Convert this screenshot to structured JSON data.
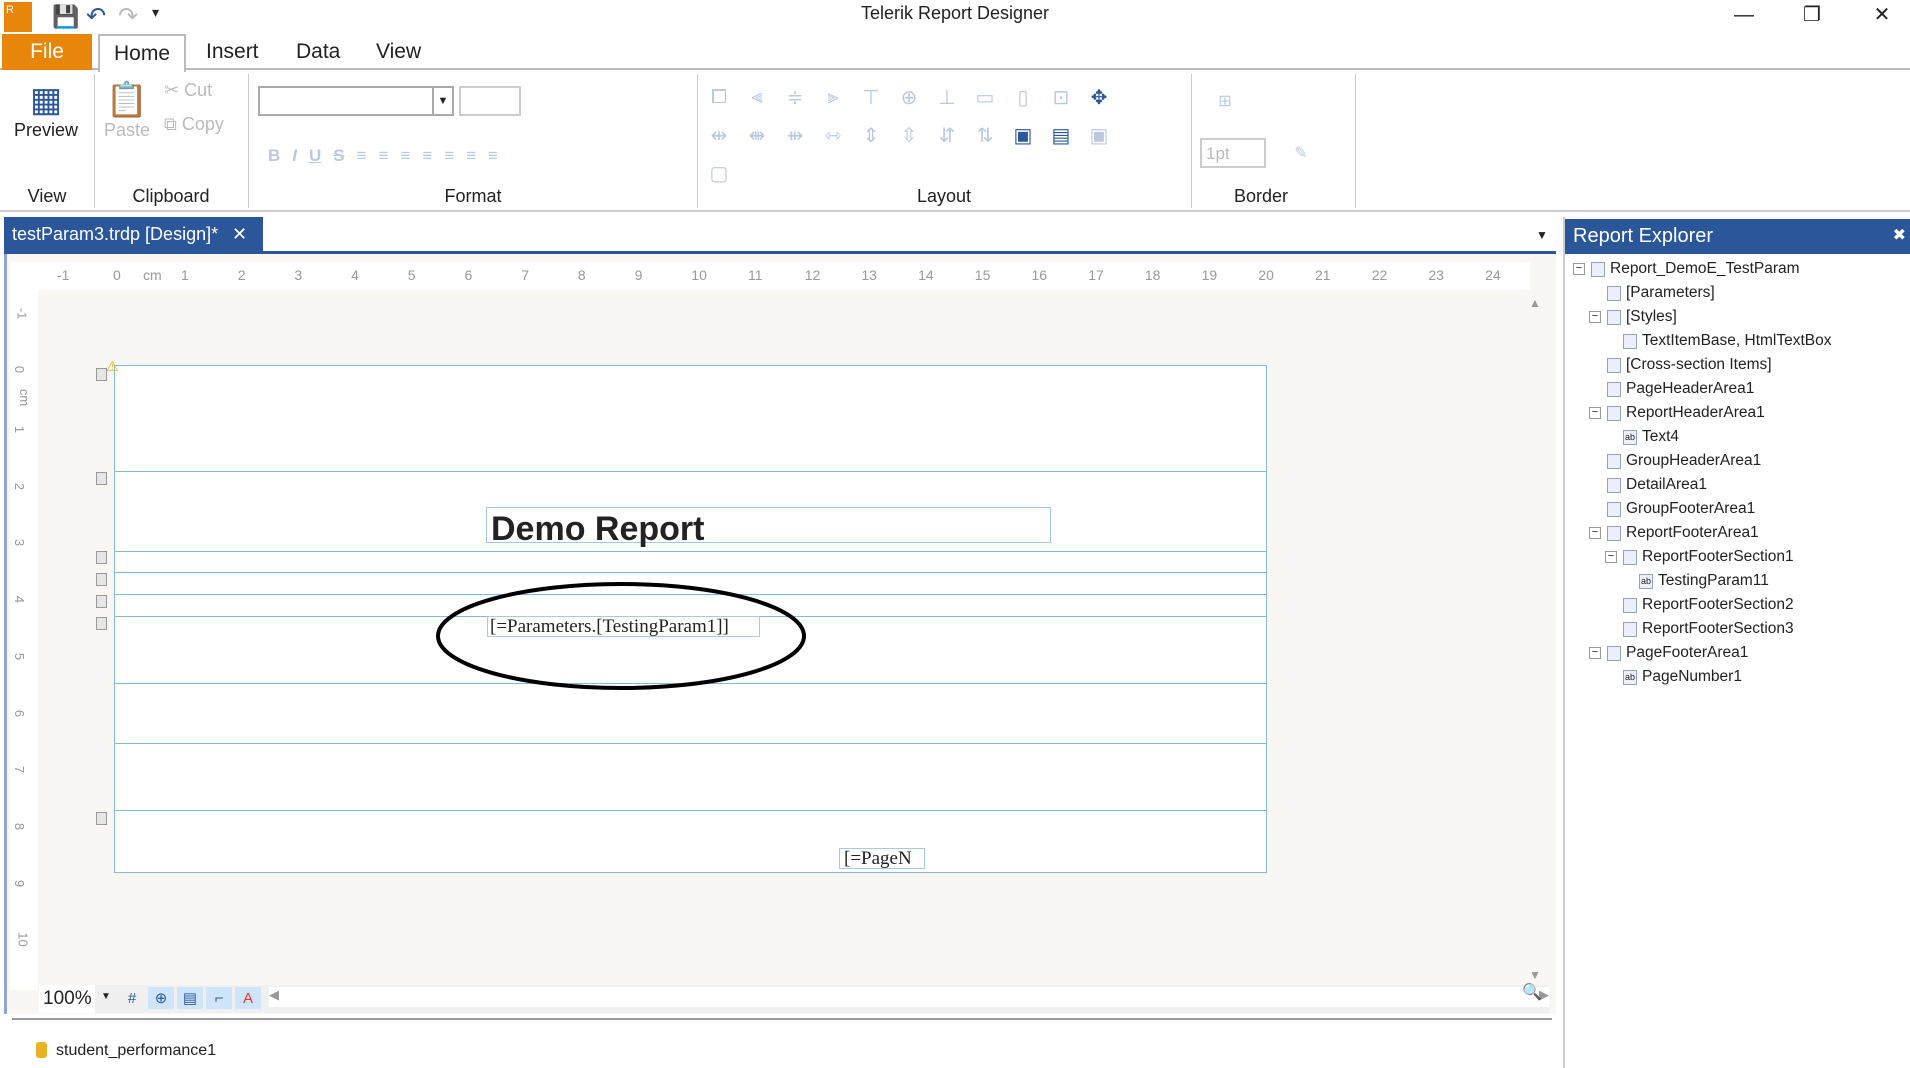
{
  "app": {
    "title": "Telerik Report Designer"
  },
  "quick_access": {
    "icons": [
      "app-logo-icon",
      "save-icon",
      "undo-icon",
      "redo-icon",
      "customize-icon"
    ]
  },
  "window_controls": {
    "minimize": "—",
    "restore": "❐",
    "close": "✕"
  },
  "ribbon": {
    "tabs": [
      {
        "label": "File"
      },
      {
        "label": "Home"
      },
      {
        "label": "Insert"
      },
      {
        "label": "Data"
      },
      {
        "label": "View"
      }
    ],
    "groups": {
      "view": "View",
      "clipboard": "Clipboard",
      "format": "Format",
      "layout": "Layout",
      "border": "Border"
    },
    "preview": "Preview",
    "paste": "Paste",
    "cut": "Cut",
    "copy": "Copy",
    "font_name": "",
    "font_size": "",
    "format_buttons": [
      "B",
      "I",
      "U",
      "S"
    ],
    "border_width": "1pt"
  },
  "document": {
    "tab": "testParam3.trdp [Design]*",
    "close": "✕"
  },
  "ruler": {
    "h": [
      "-1",
      "0",
      "cm",
      "1",
      "2",
      "3",
      "4",
      "5",
      "6",
      "7",
      "8",
      "9",
      "10",
      "11",
      "12",
      "13",
      "14",
      "15",
      "16",
      "17",
      "18",
      "19",
      "20",
      "21",
      "22",
      "23",
      "24"
    ],
    "v": [
      "-1",
      "0",
      "cm",
      "1",
      "2",
      "3",
      "4",
      "5",
      "6",
      "7",
      "8",
      "9",
      "10"
    ]
  },
  "canvas": {
    "title": "Demo Report",
    "param": "[=Parameters.[TestingParam1]]",
    "page_number": "[=PageN"
  },
  "bottom": {
    "zoom": "100%"
  },
  "datasource": {
    "name": "student_performance1"
  },
  "explorer": {
    "title": "Report Explorer",
    "close": "✖",
    "items": [
      {
        "label": "Report_DemoE_TestParam",
        "level": 0,
        "expand": true
      },
      {
        "label": "[Parameters]",
        "level": 1
      },
      {
        "label": "[Styles]",
        "level": 1,
        "expand": true
      },
      {
        "label": "TextItemBase, HtmlTextBox",
        "level": 2
      },
      {
        "label": "[Cross-section Items]",
        "level": 1
      },
      {
        "label": "PageHeaderArea1",
        "level": 1
      },
      {
        "label": "ReportHeaderArea1",
        "level": 1,
        "expand": true
      },
      {
        "label": "Text4",
        "level": 2
      },
      {
        "label": "GroupHeaderArea1",
        "level": 1
      },
      {
        "label": "DetailArea1",
        "level": 1
      },
      {
        "label": "GroupFooterArea1",
        "level": 1
      },
      {
        "label": "ReportFooterArea1",
        "level": 1,
        "expand": true
      },
      {
        "label": "ReportFooterSection1",
        "level": 2,
        "expand": true
      },
      {
        "label": "TestingParam11",
        "level": 3
      },
      {
        "label": "ReportFooterSection2",
        "level": 2
      },
      {
        "label": "ReportFooterSection3",
        "level": 2
      },
      {
        "label": "PageFooterArea1",
        "level": 1,
        "expand": true
      },
      {
        "label": "PageNumber1",
        "level": 2
      }
    ]
  },
  "colors": {
    "accent": "#2b579a",
    "file_tab": "#e8860c",
    "band_line": "#8bb6dc"
  }
}
